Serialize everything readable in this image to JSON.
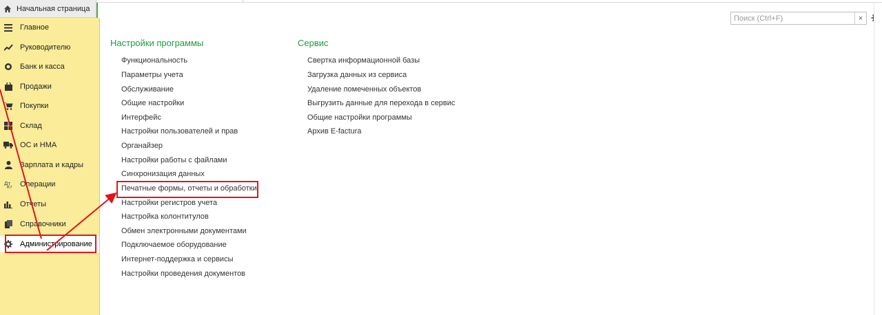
{
  "tabs": {
    "home": "Начальная страница"
  },
  "search": {
    "placeholder": "Поиск (Ctrl+F)",
    "clear": "×"
  },
  "sidebar": {
    "items": [
      {
        "label": "Главное",
        "icon": "menu-icon"
      },
      {
        "label": "Руководителю",
        "icon": "trend-icon"
      },
      {
        "label": "Банк и касса",
        "icon": "coins-icon"
      },
      {
        "label": "Продажи",
        "icon": "bag-icon"
      },
      {
        "label": "Покупки",
        "icon": "cart-icon"
      },
      {
        "label": "Склад",
        "icon": "warehouse-icon"
      },
      {
        "label": "ОС и НМА",
        "icon": "truck-icon"
      },
      {
        "label": "Зарплата и кадры",
        "icon": "person-icon"
      },
      {
        "label": "Операции",
        "icon": "operations-icon"
      },
      {
        "label": "Отчеты",
        "icon": "bar-chart-icon"
      },
      {
        "label": "Справочники",
        "icon": "books-icon"
      },
      {
        "label": "Администрирование",
        "icon": "gear-icon"
      }
    ]
  },
  "settings": {
    "title": "Настройки программы",
    "links": [
      "Функциональность",
      "Параметры учета",
      "Обслуживание",
      "Общие настройки",
      "Интерфейс",
      "Настройки пользователей и прав",
      "Органайзер",
      "Настройки работы с файлами",
      "Синхронизация данных",
      "Печатные формы, отчеты и обработки",
      "Настройки регистров учета",
      "Настройка колонтитулов",
      "Обмен электронными документами",
      "Подключаемое оборудование",
      "Интернет-поддержка и сервисы",
      "Настройки проведения документов"
    ]
  },
  "service": {
    "title": "Сервис",
    "links": [
      "Свертка информационной базы",
      "Загрузка данных из сервиса",
      "Удаление помеченных объектов",
      "Выгрузить данные для перехода в сервис",
      "Общие настройки программы",
      "Архив E-factura"
    ]
  },
  "colors": {
    "sidebar_bg": "#fbec99",
    "section_title": "#1a9c3c",
    "annotation": "#e0141e"
  }
}
